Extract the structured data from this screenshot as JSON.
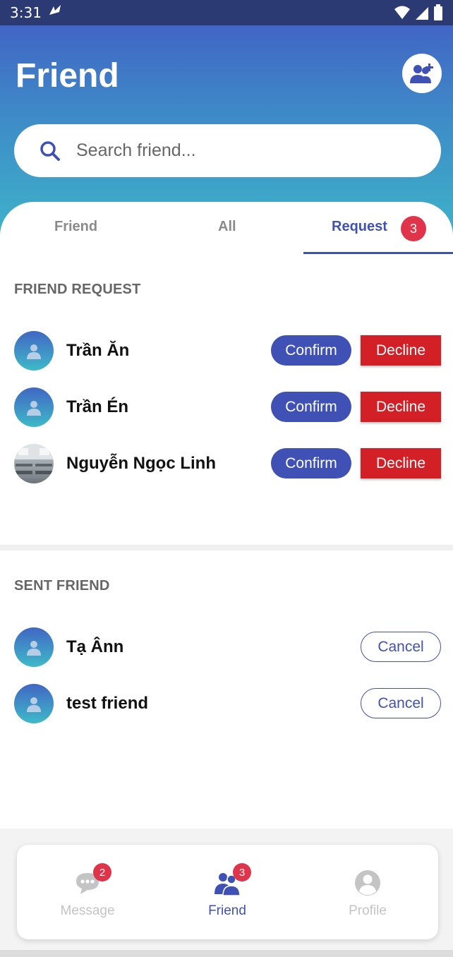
{
  "status_bar": {
    "time": "3:31"
  },
  "header": {
    "title": "Friend",
    "search_placeholder": "Search friend..."
  },
  "tabs": [
    {
      "label": "Friend",
      "active": false
    },
    {
      "label": "All",
      "active": false
    },
    {
      "label": "Request",
      "active": true,
      "badge": "3"
    }
  ],
  "friend_request": {
    "title": "FRIEND REQUEST",
    "confirm_label": "Confirm",
    "decline_label": "Decline",
    "items": [
      {
        "name": "Trần Ăn",
        "avatar": "default"
      },
      {
        "name": "Trần Én",
        "avatar": "default"
      },
      {
        "name": "Nguyễn Ngọc Linh",
        "avatar": "photo"
      }
    ]
  },
  "sent_friend": {
    "title": "SENT FRIEND",
    "cancel_label": "Cancel",
    "items": [
      {
        "name": "Tạ Ânn",
        "avatar": "default"
      },
      {
        "name": "test friend",
        "avatar": "default"
      }
    ]
  },
  "bottom_nav": {
    "items": [
      {
        "label": "Message",
        "icon": "chat-icon",
        "badge": "2",
        "active": false
      },
      {
        "label": "Friend",
        "icon": "friends-icon",
        "badge": "3",
        "active": true
      },
      {
        "label": "Profile",
        "icon": "profile-icon",
        "active": false
      }
    ]
  },
  "colors": {
    "accent": "#3f51b5",
    "decline": "#d32027",
    "badge": "#e0344a",
    "header_top": "#4166c4",
    "header_bottom": "#3eb3c9"
  }
}
